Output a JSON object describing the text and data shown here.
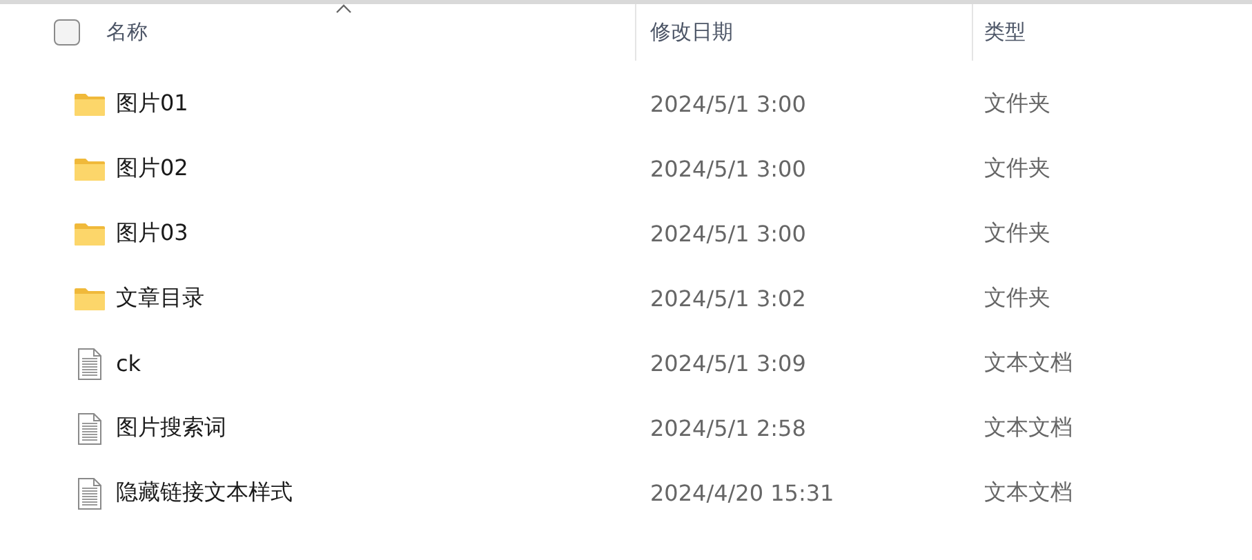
{
  "header": {
    "select_all": {
      "checked": false
    },
    "columns": [
      "名称",
      "修改日期",
      "类型"
    ]
  },
  "rows": [
    {
      "kind": "folder",
      "name": "图片01",
      "modified": "2024/5/1 3:00",
      "type": "文件夹"
    },
    {
      "kind": "folder",
      "name": "图片02",
      "modified": "2024/5/1 3:00",
      "type": "文件夹"
    },
    {
      "kind": "folder",
      "name": "图片03",
      "modified": "2024/5/1 3:00",
      "type": "文件夹"
    },
    {
      "kind": "folder",
      "name": "文章目录",
      "modified": "2024/5/1 3:02",
      "type": "文件夹"
    },
    {
      "kind": "file",
      "name": "ck",
      "modified": "2024/5/1 3:09",
      "type": "文本文档"
    },
    {
      "kind": "file",
      "name": "图片搜索词",
      "modified": "2024/5/1 2:58",
      "type": "文本文档"
    },
    {
      "kind": "file",
      "name": "隐藏链接文本样式",
      "modified": "2024/4/20 15:31",
      "type": "文本文档"
    }
  ]
}
